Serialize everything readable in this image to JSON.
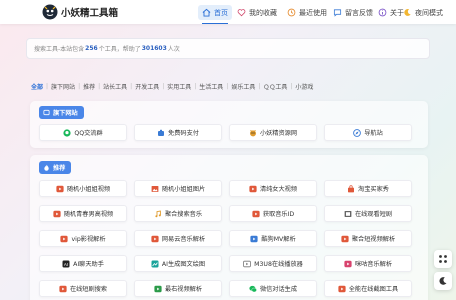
{
  "site": {
    "title": "小妖精工具箱"
  },
  "nav": [
    {
      "label": "首页",
      "icon": "home-icon",
      "active": true
    },
    {
      "label": "我的收藏",
      "icon": "heart-icon"
    },
    {
      "label": "最近使用",
      "icon": "clock-icon"
    },
    {
      "label": "留言反馈",
      "icon": "chat-icon"
    },
    {
      "label": "关于",
      "icon": "info-icon"
    },
    {
      "label": "夜间模式",
      "icon": "moon-icon"
    }
  ],
  "search": {
    "prefix": "搜索工具-本站包含",
    "tool_count": "256",
    "middle": "个工具，帮助了",
    "user_count": "301603",
    "suffix": "人次"
  },
  "categories": [
    "全部",
    "旗下网站",
    "推荐",
    "站长工具",
    "开发工具",
    "实用工具",
    "生活工具",
    "娱乐工具",
    "ＱＱ工具",
    "小游戏"
  ],
  "sections": {
    "network": {
      "label": "旗下网站",
      "items": [
        {
          "label": "QQ交流群",
          "icon": "qq-icon",
          "color": "#18b85a"
        },
        {
          "label": "免费码支付",
          "icon": "pay-icon",
          "color": "#3a7bd5"
        },
        {
          "label": "小妖精资源网",
          "icon": "fairy-icon",
          "color": "#e09b2d"
        },
        {
          "label": "导航站",
          "icon": "compass-icon",
          "color": "#3a7bd5"
        }
      ]
    },
    "recommend": {
      "label": "推荐",
      "items": [
        {
          "label": "随机小姐姐视频",
          "icon": "video-icon",
          "color": "#e0583a"
        },
        {
          "label": "随机小姐姐图片",
          "icon": "image-icon",
          "color": "#e0583a"
        },
        {
          "label": "清纯女大视频",
          "icon": "video-icon",
          "color": "#e0583a"
        },
        {
          "label": "淘宝买家秀",
          "icon": "shopping-icon",
          "color": "#e0583a"
        },
        {
          "label": "随机青春男高视频",
          "icon": "video-icon",
          "color": "#e0583a"
        },
        {
          "label": "聚合搜索音乐",
          "icon": "music-icon",
          "color": "#e09b2d"
        },
        {
          "label": "获取音乐ID",
          "icon": "music-id-icon",
          "color": "#e0583a"
        },
        {
          "label": "在线观看短剧",
          "icon": "film-icon",
          "color": "#666666"
        },
        {
          "label": "vip影视解析",
          "icon": "video-icon",
          "color": "#e0583a"
        },
        {
          "label": "网易云音乐解析",
          "icon": "netease-icon",
          "color": "#e0583a"
        },
        {
          "label": "酷狗MV解析",
          "icon": "kugou-icon",
          "color": "#3a7bd5"
        },
        {
          "label": "聚合短视频解析",
          "icon": "video-icon",
          "color": "#e0583a"
        },
        {
          "label": "AI聊天助手",
          "icon": "ai-icon",
          "color": "#222222"
        },
        {
          "label": "AI生成图文绘图",
          "icon": "ai-draw-icon",
          "color": "#1aa39a"
        },
        {
          "label": "M3U8在线播放器",
          "icon": "player-icon",
          "color": "#777777"
        },
        {
          "label": "咪咕音乐解析",
          "icon": "migu-icon",
          "color": "#d8436e"
        },
        {
          "label": "在线短剧搜索",
          "icon": "video-icon",
          "color": "#e0583a"
        },
        {
          "label": "最右视频解析",
          "icon": "zuiyou-icon",
          "color": "#2c9b4a"
        },
        {
          "label": "微信对话生成",
          "icon": "wechat-icon",
          "color": "#18b85a"
        },
        {
          "label": "全能在线截图工具",
          "icon": "screenshot-icon",
          "color": "#e0583a"
        }
      ]
    }
  },
  "colors": {
    "accent": "#2a6fd6",
    "tag_bg": "#4a86e8"
  }
}
